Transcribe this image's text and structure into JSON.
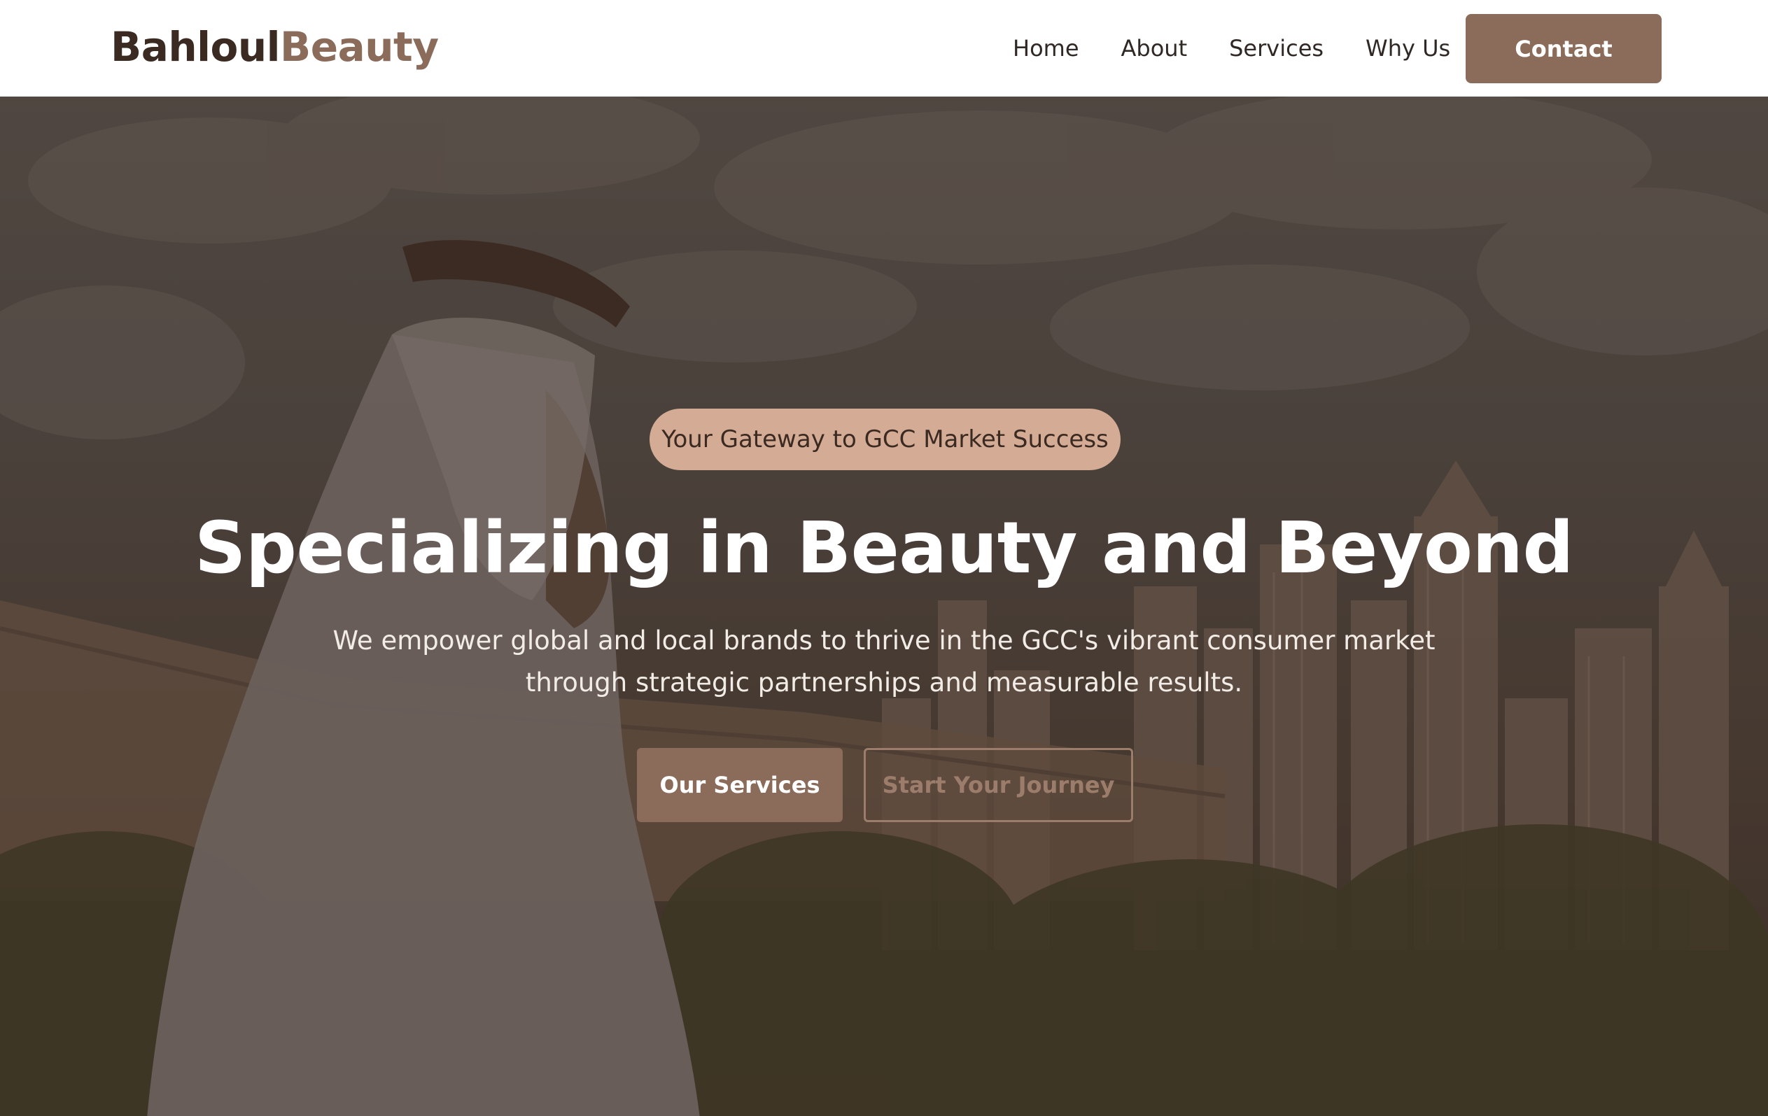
{
  "brand": {
    "name_part1": "Bahloul",
    "name_part2": "Beauty"
  },
  "nav": {
    "items": [
      {
        "label": "Home"
      },
      {
        "label": "About"
      },
      {
        "label": "Services"
      },
      {
        "label": "Why Us"
      }
    ],
    "contact_label": "Contact"
  },
  "hero": {
    "tagline": "Your Gateway to GCC Market Success",
    "headline": "Specializing in Beauty and Beyond",
    "subtext": "We empower global and local brands to thrive in the GCC's vibrant consumer market through strategic partnerships and measurable results.",
    "primary_cta": "Our Services",
    "secondary_cta": "Start Your Journey"
  },
  "colors": {
    "accent": "#8b6b5a",
    "pill": "#d4ab94",
    "brand_dark": "#3a2a21"
  }
}
